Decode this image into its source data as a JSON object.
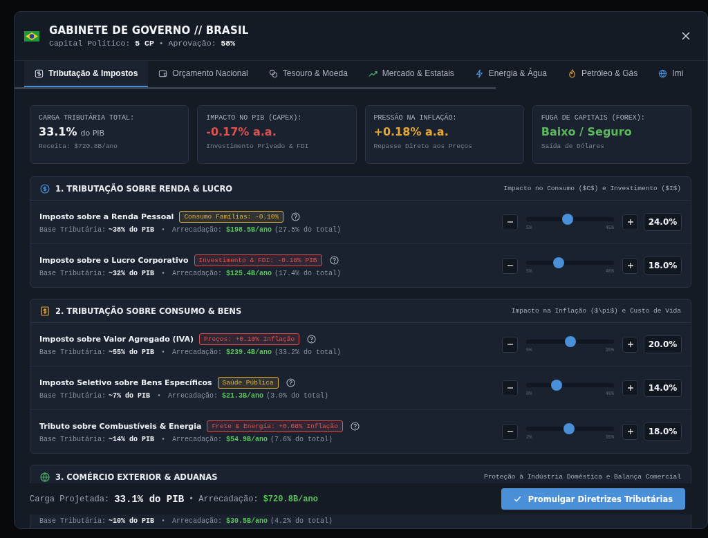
{
  "window": {
    "title": "GABINETE DE GOVERNO // BRASIL",
    "subtitle": "Capital Político: **5 CP** • Aprovação: **58%**"
  },
  "tabs": [
    {
      "label": "Tributação & Impostos",
      "selected": true
    },
    {
      "label": "Orçamento Nacional",
      "selected": false
    },
    {
      "label": "Tesouro & Moeda",
      "selected": false
    },
    {
      "label": "Mercado & Estatais",
      "selected": false
    },
    {
      "label": "Energia & Água",
      "selected": false
    },
    {
      "label": "Petróleo & Gás",
      "selected": false
    },
    {
      "label": "Imi",
      "selected": false
    }
  ],
  "stats": [
    {
      "label": "CARGA TRIBUTÁRIA TOTAL:",
      "value": "33.1%",
      "suffix": "do PIB",
      "note": "Receita: $720.8B/ano",
      "color": "#f2f4f7"
    },
    {
      "label": "IMPACTO NO PIB (CAPEX):",
      "value": "-0.17% a.a.",
      "note": "Investimento Privado & FDI",
      "color": "#e0514f"
    },
    {
      "label": "PRESSÃO NA INFLAÇÃO:",
      "value": "+0.18% a.a.",
      "note": "Repasse Direto aos Preços",
      "color": "#e6a732"
    },
    {
      "label": "FUGA DE CAPITAIS (FOREX):",
      "value": "Baixo / Seguro",
      "note": "Saída de Dólares",
      "color": "#5cb85c"
    }
  ],
  "sections": [
    {
      "title": "1. TRIBUTAÇÃO SOBRE RENDA & LUCRO",
      "caption": "Impacto no Consumo ($C$) e Investimento ($I$)",
      "rows": [
        {
          "name": "Imposto sobre a Renda Pessoal",
          "badge": "Consumo Famílias: -0.10%",
          "color": "#e0b341",
          "base_label": "Base Tributária:",
          "base": "~38% do PIB",
          "sep": "•",
          "rev_label": "Arrecadação:",
          "revenue": "$198.5B/ano",
          "share": "(27.5% do total)",
          "min": "5%",
          "max": "45%",
          "level": 0.475,
          "value": "24.0%"
        },
        {
          "name": "Imposto sobre o Lucro Corporativo",
          "badge": "Investimento & FDI: -0.18% PIB",
          "color": "#e05252",
          "base_label": "Base Tributária:",
          "base": "~32% do PIB",
          "sep": "•",
          "rev_label": "Arrecadação:",
          "revenue": "$125.4B/ano",
          "share": "(17.4% do total)",
          "min": "5%",
          "max": "40%",
          "level": 0.37,
          "value": "18.0%"
        }
      ]
    },
    {
      "title": "2. TRIBUTAÇÃO SOBRE CONSUMO & BENS",
      "caption": "Impacto na Inflação ($\\pi$) e Custo de Vida",
      "rows": [
        {
          "name": "Imposto sobre Valor Agregado (IVA)",
          "badge": "Preços: +0.10% Inflação",
          "color": "#e05252",
          "base_label": "Base Tributária:",
          "base": "~55% do PIB",
          "sep": "•",
          "rev_label": "Arrecadação:",
          "revenue": "$239.4B/ano",
          "share": "(33.2% do total)",
          "min": "5%",
          "max": "35%",
          "level": 0.5,
          "value": "20.0%"
        },
        {
          "name": "Imposto Seletivo sobre Bens Específicos",
          "badge": "Saúde Pública",
          "color": "#e0b341",
          "base_label": "Base Tributária:",
          "base": "~7% do PIB",
          "sep": "•",
          "rev_label": "Arrecadação:",
          "revenue": "$21.3B/ano",
          "share": "(3.0% do total)",
          "min": "0%",
          "max": "40%",
          "level": 0.35,
          "value": "14.0%"
        },
        {
          "name": "Tributo sobre Combustíveis & Energia",
          "badge": "Frete & Energia: +0.08% Inflação",
          "color": "#e05252",
          "base_label": "Base Tributária:",
          "base": "~14% do PIB",
          "sep": "•",
          "rev_label": "Arrecadação:",
          "revenue": "$54.9B/ano",
          "share": "(7.6% do total)",
          "min": "2%",
          "max": "35%",
          "level": 0.485,
          "value": "18.0%"
        }
      ]
    },
    {
      "title": "3. COMÉRCIO EXTERIOR & ADUANAS",
      "caption": "Proteção à Indústria Doméstica e Balança Comercial",
      "rows": [
        {
          "base_label": "Base Tributária:",
          "base": "~10% do PIB",
          "sep": "•",
          "rev_label": "Arrecadação:",
          "revenue": "$30.5B/ano",
          "share": "(4.2% do total)"
        }
      ]
    }
  ],
  "footer": {
    "label": "Carga Projetada:",
    "value": "33.1% do PIB",
    "sep": "•",
    "rev_label": "Arrecadação:",
    "revenue": "$720.8B/ano",
    "button": "Promulgar Diretrizes Tributárias"
  }
}
